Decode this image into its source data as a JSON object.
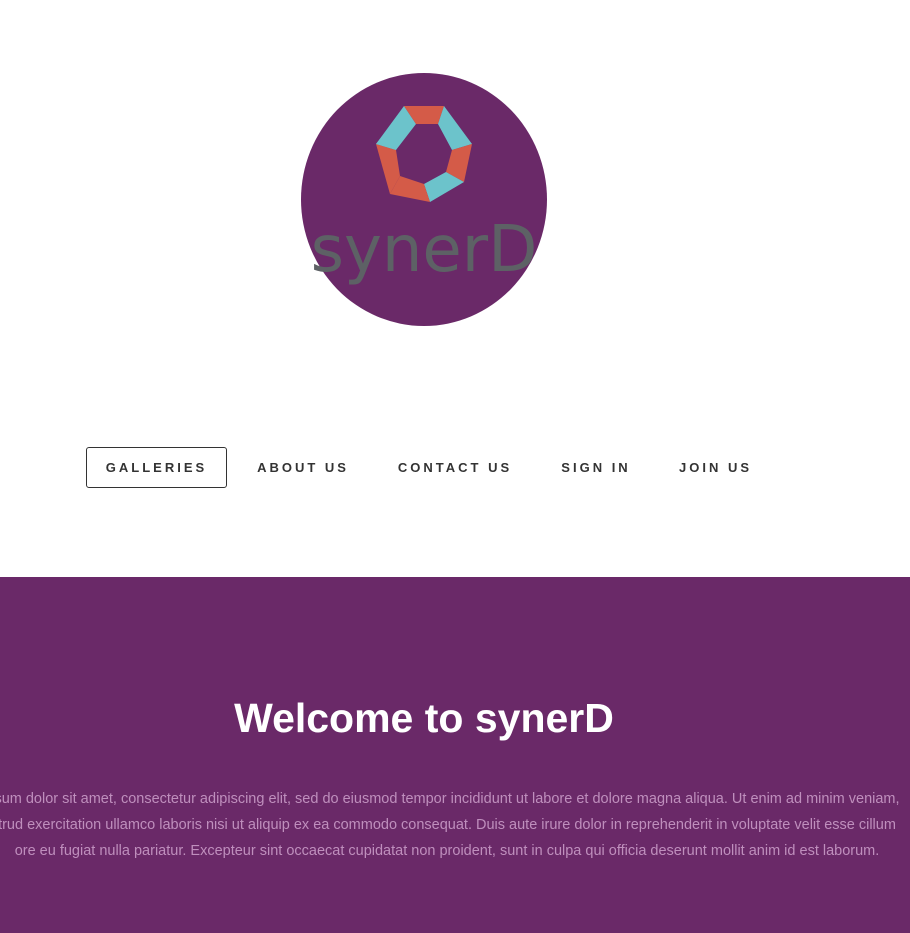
{
  "logo": {
    "wordmark": "synerD",
    "colors": {
      "circle": "#6a2968",
      "ring_red": "#d45b48",
      "ring_teal": "#6cc3cb",
      "wordmark": "#5d6165"
    }
  },
  "nav": {
    "items": [
      {
        "label": "GALLERIES",
        "active": true
      },
      {
        "label": "ABOUT US",
        "active": false
      },
      {
        "label": "CONTACT US",
        "active": false
      },
      {
        "label": "SIGN IN",
        "active": false
      },
      {
        "label": "JOIN US",
        "active": false
      }
    ]
  },
  "hero": {
    "background": "#6a2968",
    "title": "Welcome to synerD",
    "body_lines": [
      "sum dolor sit amet, consectetur adipiscing elit, sed do eiusmod tempor incididunt ut labore et dolore magna aliqua. Ut enim ad minim veniam,",
      "trud exercitation ullamco laboris nisi ut aliquip ex ea commodo consequat. Duis aute irure dolor in reprehenderit in voluptate velit esse cillum",
      "ore eu fugiat nulla pariatur. Excepteur sint occaecat cupidatat non proident, sunt in culpa qui officia deserunt mollit anim id est laborum."
    ]
  }
}
